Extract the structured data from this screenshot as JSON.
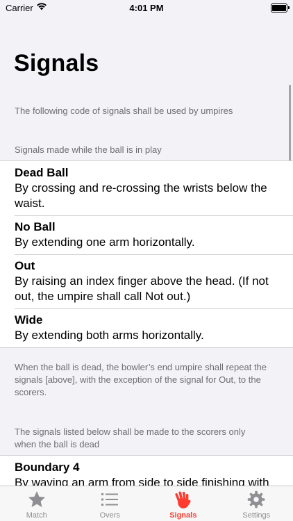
{
  "status_bar": {
    "carrier": "Carrier",
    "time": "4:01 PM"
  },
  "page_title": "Signals",
  "intro_note": "The following code of signals shall be used by umpires",
  "section_in_play": {
    "header": "Signals made while the ball is in play",
    "items": [
      {
        "title": "Dead Ball",
        "description": "By crossing and re-crossing the wrists below the waist."
      },
      {
        "title": "No Ball",
        "description": "By extending one arm horizontally."
      },
      {
        "title": "Out",
        "description": "By raising an index finger above the head. (If not out, the umpire shall call Not out.)"
      },
      {
        "title": "Wide",
        "description": "By extending both arms horizontally."
      }
    ],
    "footer": "When the ball is dead, the bowler’s end umpire shall repeat the signals [above], with the exception of the signal for Out, to the scorers."
  },
  "section_dead_ball": {
    "header": "The signals listed below shall be made to the scorers only when the ball is dead",
    "items": [
      {
        "title": "Boundary 4",
        "description": "By waving an arm from side to side finishing with"
      }
    ]
  },
  "tab_bar": {
    "tabs": [
      {
        "label": "Match",
        "icon": "star-icon"
      },
      {
        "label": "Overs",
        "icon": "list-icon"
      },
      {
        "label": "Signals",
        "icon": "hand-icon",
        "active": true
      },
      {
        "label": "Settings",
        "icon": "gear-icon"
      }
    ],
    "active_color": "#ff3b30",
    "inactive_color": "#8e8e93"
  }
}
